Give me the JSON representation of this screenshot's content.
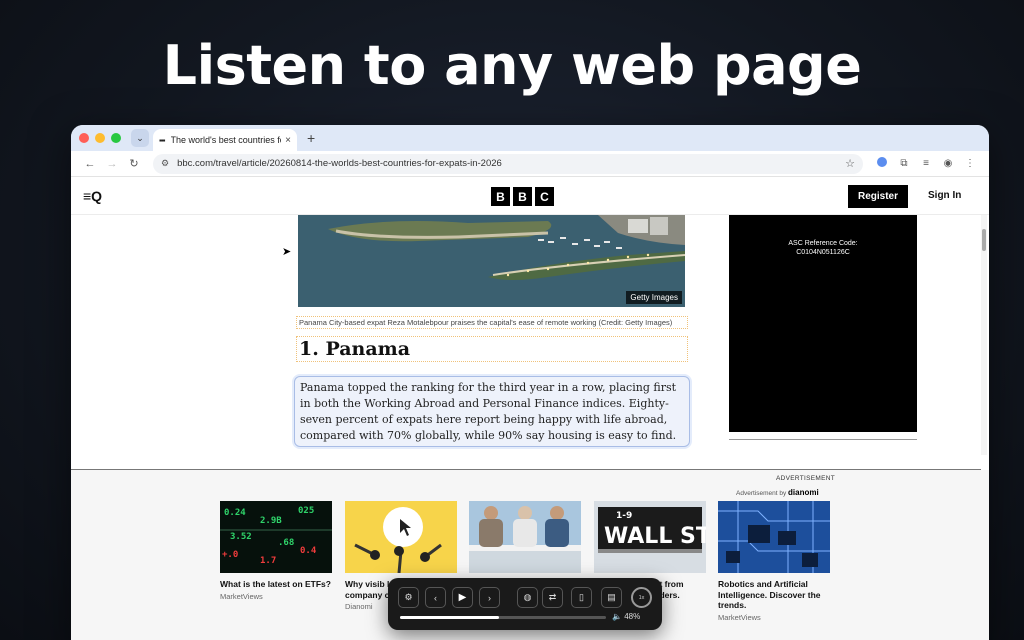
{
  "hero": {
    "title": "Listen to any web page"
  },
  "browser": {
    "tab": {
      "title": "The world's best countries for",
      "close": "×"
    },
    "new_tab": "+",
    "url": "bbc.com/travel/article/20260814-the-worlds-best-countries-for-expats-in-2026"
  },
  "bbc": {
    "logo": [
      "B",
      "B",
      "C"
    ],
    "register": "Register",
    "signin": "Sign In"
  },
  "article": {
    "image_credit": "Getty Images",
    "caption": "Panama City-based expat Reza Motalebpour praises the capital's ease of remote working (Credit: Getty Images)",
    "heading": "1. Panama",
    "paragraph": "Panama topped the ranking for the third year in a row, placing first in both the Working Abroad and Personal Finance indices. Eighty-seven percent of expats here report being happy with life abroad, compared with 70% globally, while 90% say housing is easy to find."
  },
  "side_ad": {
    "ref_label": "ASC Reference Code:",
    "ref_code": "C0104N051126C"
  },
  "ads": {
    "label": "ADVERTISEMENT",
    "by": "Advertisement by",
    "brand": "dianomi",
    "cards": [
      {
        "title": "What is the latest on ETFs?",
        "source": "MarketViews"
      },
      {
        "title": "Why visib longer en company communi",
        "source": "Dianomi"
      },
      {
        "title": "",
        "source": ""
      },
      {
        "title": "est from eaders.",
        "source": ""
      },
      {
        "title": "Robotics and Artificial Intelligence. Discover the trends.",
        "source": "MarketViews"
      }
    ],
    "wall_st": "WALL ST",
    "wall_num": "1-9"
  },
  "player": {
    "progress": 0.48,
    "volume": "48%",
    "speed": "1x"
  }
}
